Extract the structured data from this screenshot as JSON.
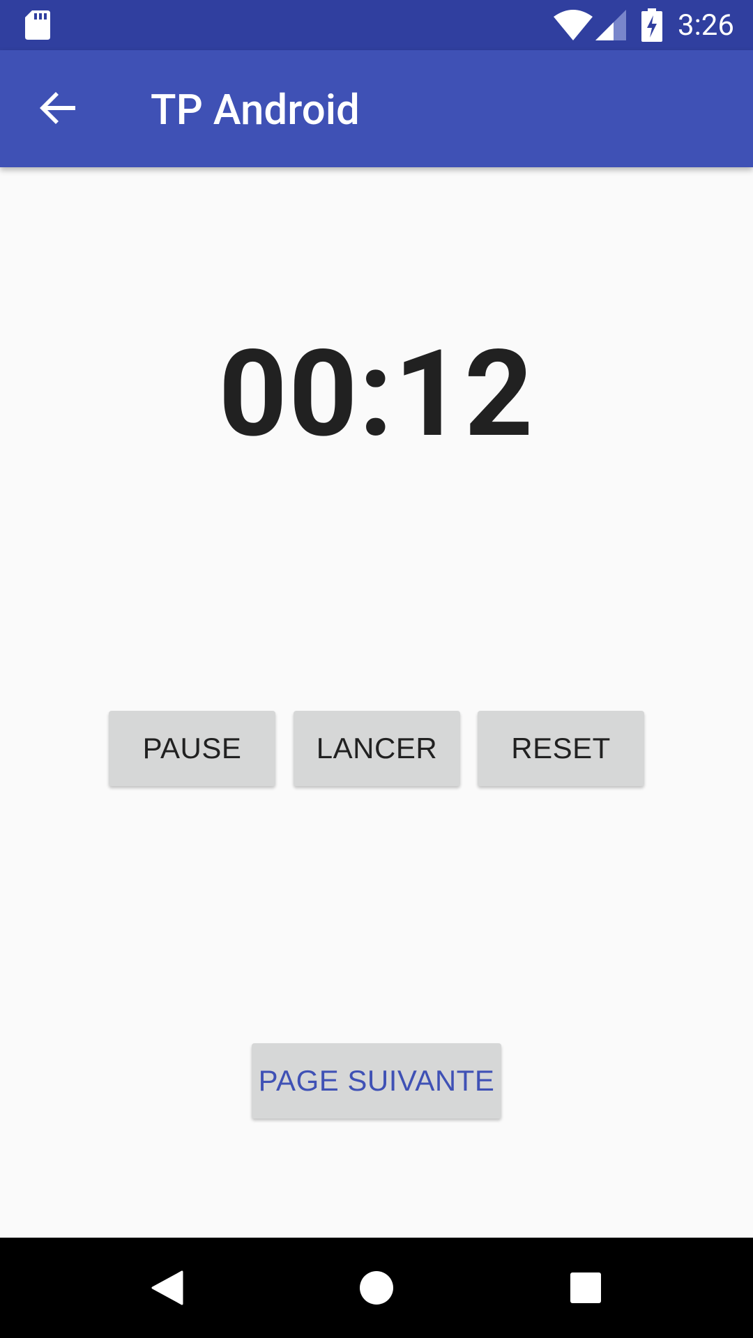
{
  "status_bar": {
    "time": "3:26",
    "icons": [
      "sd-card-icon",
      "wifi-icon",
      "cell-signal-icon",
      "battery-charging-icon"
    ]
  },
  "app_bar": {
    "title": "TP Android",
    "nav_icon": "arrow-back-icon"
  },
  "timer": {
    "display": "00:12"
  },
  "controls": {
    "pause_label": "PAUSE",
    "lancer_label": "LANCER",
    "reset_label": "RESET"
  },
  "next_page": {
    "label": "PAGE SUIVANTE"
  },
  "nav_bar": {
    "buttons": [
      "back-triangle-icon",
      "home-circle-icon",
      "recents-square-icon"
    ]
  },
  "colors": {
    "status_bar": "#303f9f",
    "app_bar": "#3f51b5",
    "background": "#fafafa",
    "button": "#d6d7d7",
    "accent_text": "#3f51b5",
    "timer_text": "#212121"
  }
}
